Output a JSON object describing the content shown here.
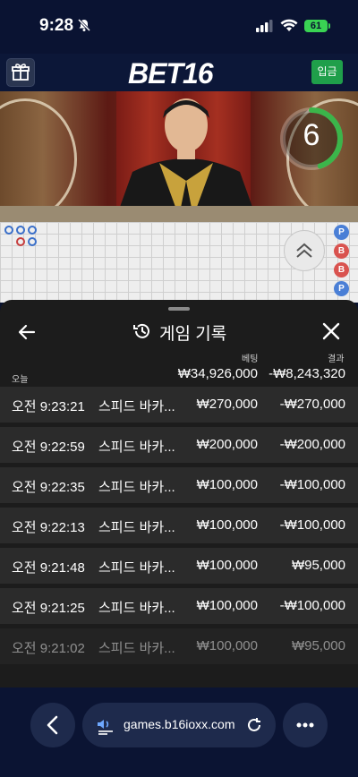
{
  "status_bar": {
    "time": "9:28",
    "battery": "61"
  },
  "topnav": {
    "brand": "BET16",
    "deposit_label": "입금"
  },
  "video": {
    "countdown": "6",
    "countdown_fraction": 0.45
  },
  "roadmap": {
    "predictions": [
      {
        "label": "P",
        "color": "#4a7fd6"
      },
      {
        "label": "B",
        "color": "#d9534f"
      },
      {
        "label": "B",
        "color": "#d9534f"
      },
      {
        "label": "P",
        "color": "#4a7fd6"
      }
    ]
  },
  "history": {
    "title": "게임 기록",
    "bet_col_label": "베팅",
    "result_col_label": "결과",
    "today_label": "오늘",
    "total_bet": "₩34,926,000",
    "total_result": "-₩8,243,320",
    "rows": [
      {
        "time": "오전 9:23:21",
        "game": "스피드 바카...",
        "bet": "₩270,000",
        "result": "-₩270,000"
      },
      {
        "time": "오전 9:22:59",
        "game": "스피드 바카...",
        "bet": "₩200,000",
        "result": "-₩200,000"
      },
      {
        "time": "오전 9:22:35",
        "game": "스피드 바카...",
        "bet": "₩100,000",
        "result": "-₩100,000"
      },
      {
        "time": "오전 9:22:13",
        "game": "스피드 바카...",
        "bet": "₩100,000",
        "result": "-₩100,000"
      },
      {
        "time": "오전 9:21:48",
        "game": "스피드 바카...",
        "bet": "₩100,000",
        "result": "₩95,000"
      },
      {
        "time": "오전 9:21:25",
        "game": "스피드 바카...",
        "bet": "₩100,000",
        "result": "-₩100,000"
      },
      {
        "time": "오전 9:21:02",
        "game": "스피드 바카...",
        "bet": "₩100,000",
        "result": "₩95,000"
      }
    ]
  },
  "browser": {
    "url": "games.b16ioxx.com"
  },
  "colors": {
    "accent_green": "#1f9f4a",
    "timer_green": "#3bb54a",
    "background": "#0c1530"
  }
}
